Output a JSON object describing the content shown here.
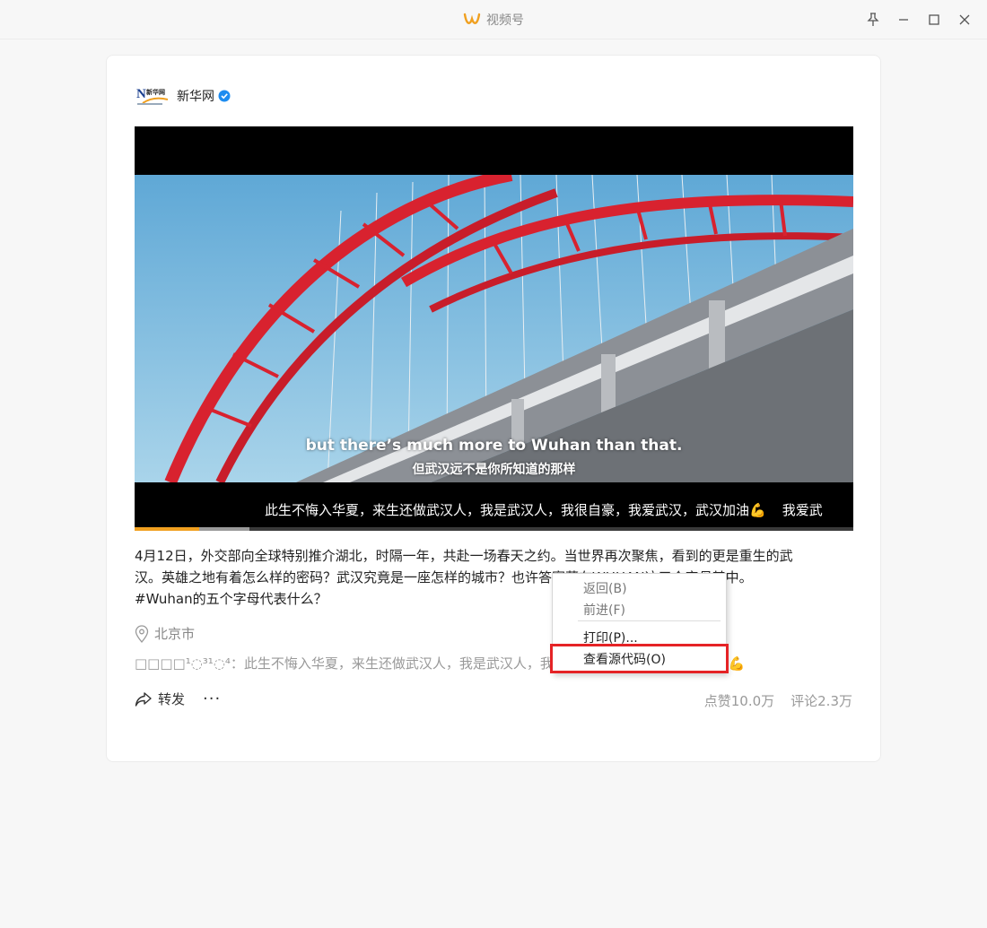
{
  "window": {
    "title": "视频号",
    "buttons": [
      "pin-icon",
      "minimize-icon",
      "maximize-icon",
      "close-icon"
    ]
  },
  "post": {
    "author": {
      "name": "新华网",
      "verified": true,
      "avatar_text": "新华网"
    },
    "video": {
      "subtitle_en": "but there’s much more to Wuhan than that.",
      "subtitle_zh": "但武汉远不是你所知道的那样",
      "danmu": [
        "此生不悔入华夏，来生还做武汉人，我是武汉人，我很自豪，我爱武汉，武汉加油💪",
        "我爱武"
      ],
      "progress_played": 0.09,
      "progress_buffered": 0.16
    },
    "description_line1": "4月12日，外交部向全球特别推介湖北，时隔一年，共赴一场春天之约。当世界再次聚焦，看到的更是重生的武",
    "description_line2": "汉。英雄之地有着怎么样的密码？武汉究竟是一座怎样的城市？也许答案藏在WUHAN这五个字母其中。",
    "description_line3": "#Wuhan的五个字母代表什么？",
    "location": "北京市",
    "comment_preview": "□□□□¹◌³¹◌⁴：此生不悔入华夏，来生还做武汉人，我是武汉人，我很自豪，我爱武汉，武汉加油💪",
    "share_label": "转发",
    "more_label": "···",
    "likes": "点赞10.0万",
    "comments": "评论2.3万"
  },
  "context_menu": {
    "items": [
      {
        "label": "返回(B)",
        "enabled": false
      },
      {
        "label": "前进(F)",
        "enabled": false
      },
      {
        "label": "打印(P)...",
        "enabled": true
      },
      {
        "label": "查看源代码(O)",
        "enabled": true,
        "highlighted": true
      }
    ]
  },
  "colors": {
    "accent": "#f0a020",
    "highlight_border": "#e52326",
    "verified_badge": "#1d8cf0",
    "bridge_red": "#d8222f",
    "sky": "#6fb4d8"
  }
}
